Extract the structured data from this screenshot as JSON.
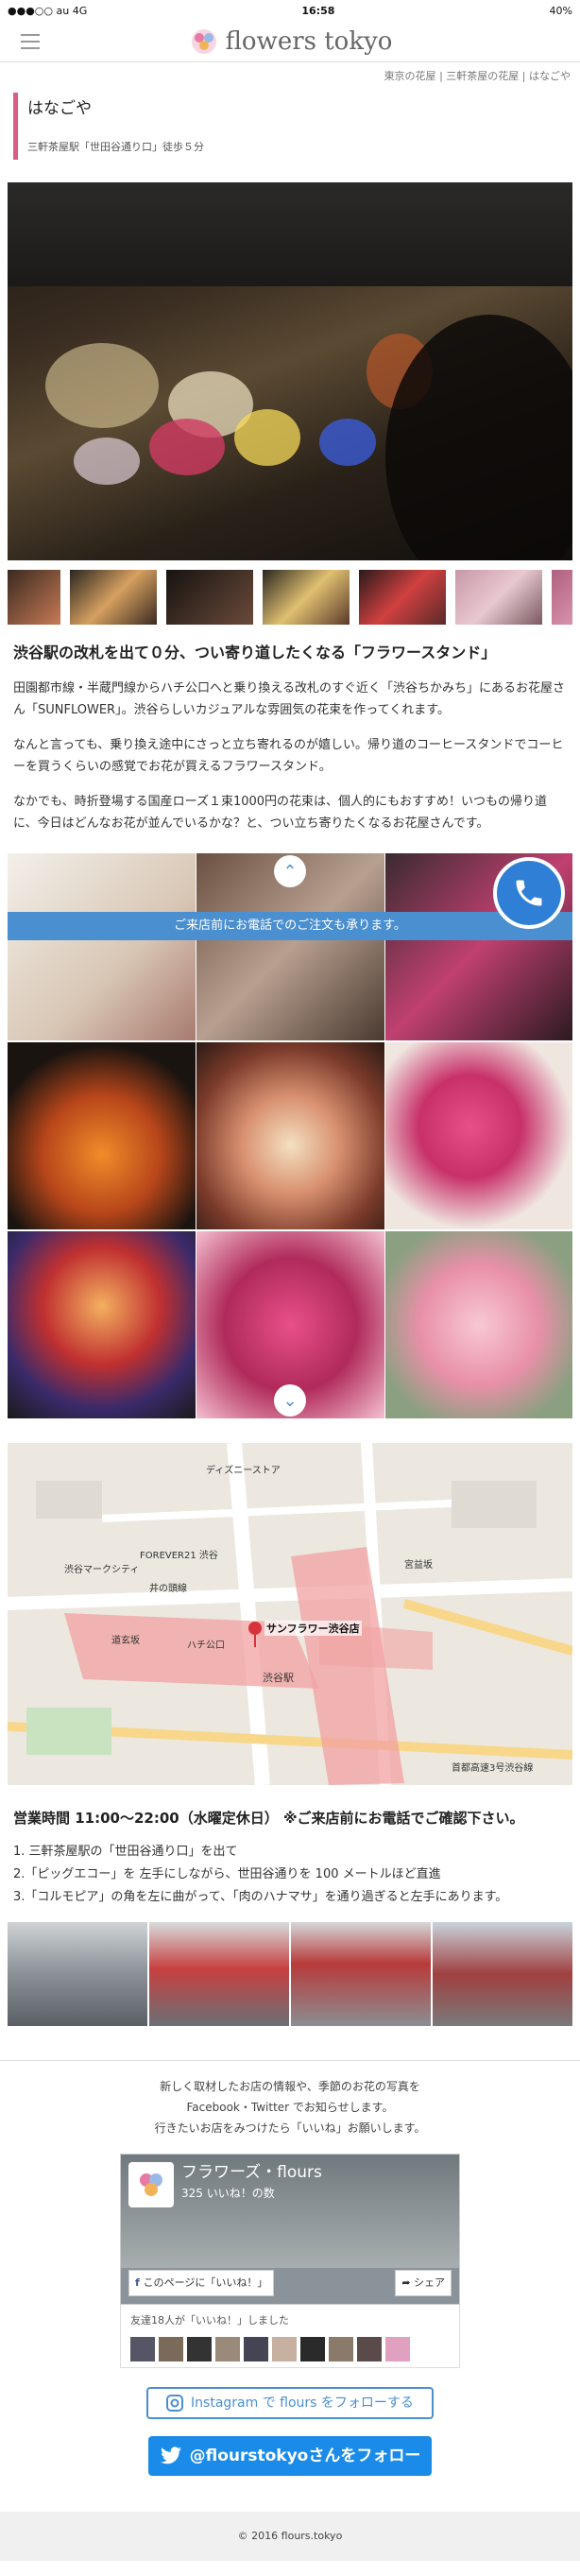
{
  "status_bar": {
    "carrier": "●●●○○ au  4G",
    "time": "16:58",
    "battery": "40%"
  },
  "header": {
    "logo_text": "flowers tokyo"
  },
  "breadcrumb": {
    "items": [
      "東京の花屋",
      "三軒茶屋の花屋",
      "はなごや"
    ],
    "separator": "|"
  },
  "shop": {
    "name": "はなごや",
    "access": "三軒茶屋駅「世田谷通り口」徒歩５分"
  },
  "intro": {
    "heading": "渋谷駅の改札を出て０分、つい寄り道したくなる「フラワースタンド」",
    "paragraphs": [
      "田園都市線・半蔵門線からハチ公口へと乗り換える改札のすぐ近く「渋谷ちかみち」にあるお花屋さん「SUNFLOWER」。渋谷らしいカジュアルな雰囲気の花束を作ってくれます。",
      "なんと言っても、乗り換え途中にさっと立ち寄れるのが嬉しい。帰り道のコーヒースタンドでコーヒーを買うくらいの感覚でお花が買えるフラワースタンド。",
      "なかでも、時折登場する国産ローズ１束1000円の花束は、個人的にもおすすめ！いつもの帰り道に、今日はどんなお花が並んでいるかな？と、つい立ち寄りたくなるお花屋さんです。"
    ]
  },
  "call": {
    "bar_text": "ご来店前にお電話でのご注文も承ります。"
  },
  "map": {
    "labels": [
      "サンフラワー渋谷店",
      "渋谷駅",
      "ハチ公口",
      "井の頭線",
      "宮益坂",
      "道玄坂",
      "ディズニーストア",
      "渋谷マークシティ",
      "FOREVER21 渋谷",
      "首都高速3号渋谷線"
    ]
  },
  "hours": {
    "text": "営業時間 11:00〜22:00（水曜定休日） ※ご来店前にお電話でご確認下さい。"
  },
  "directions": [
    "1. 三軒茶屋駅の「世田谷通り口」を出て",
    "2.「ピッグエコー」を 左手にしながら、世田谷通りを 100 メートルほど直進",
    "3.「コルモピア」の角を左に曲がって、「肉のハナマサ」を通り過ぎると左手にあります。"
  ],
  "footer": {
    "lines": [
      "新しく取材したお店の情報や、季節のお花の写真を",
      "Facebook・Twitter でお知らせします。",
      "行きたいお店をみつけたら「いいね」お願いします。"
    ],
    "fb_name": "フラワーズ・flours",
    "fb_likes": "325 いいね！の数",
    "fb_like_button": "このページに「いいね！」",
    "fb_share_button": "シェア",
    "fb_friends": "友達18人が「いいね！」しました",
    "instagram_button": "Instagram で flours をフォローする",
    "twitter_button": "@flourstokyoさんをフォロー",
    "copyright": "© 2016 flours.tokyo"
  },
  "colors": {
    "accent_pink": "#d85b8a",
    "call_blue": "#4a8fd0",
    "twitter_blue": "#1a8be8"
  }
}
